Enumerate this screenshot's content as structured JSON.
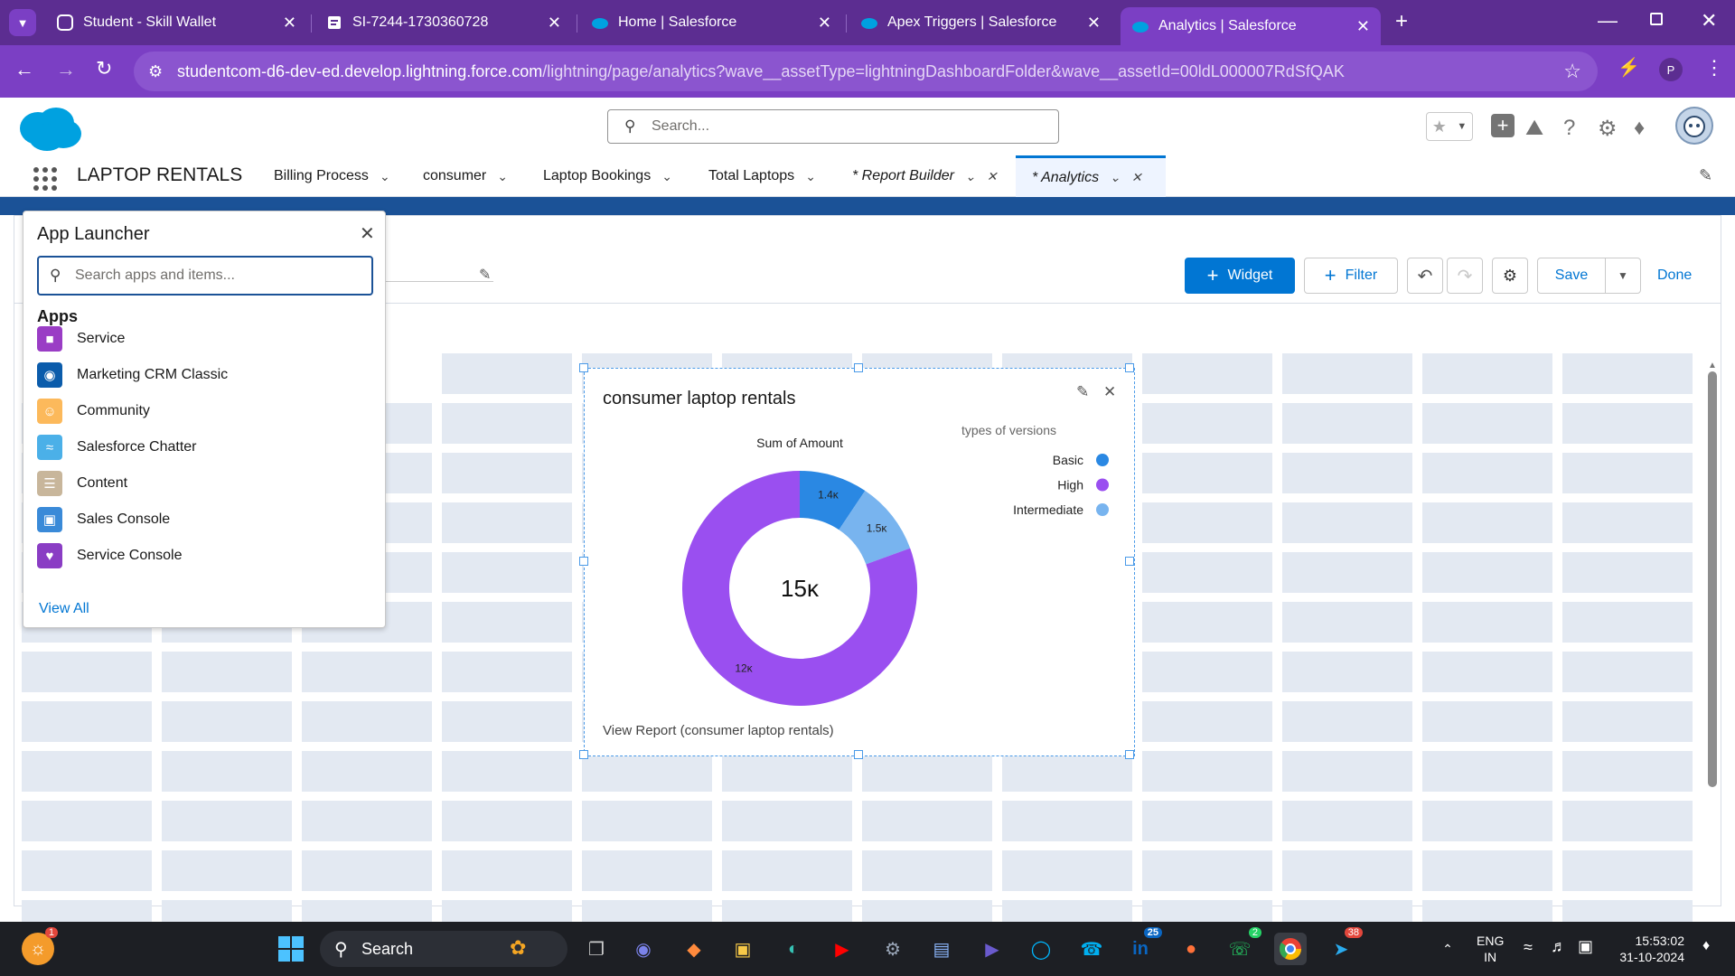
{
  "browser": {
    "tabs": [
      {
        "title": "Student - Skill Wallet"
      },
      {
        "title": "SI-7244-1730360728"
      },
      {
        "title": "Home | Salesforce"
      },
      {
        "title": "Apex Triggers | Salesforce"
      },
      {
        "title": "Analytics | Salesforce"
      }
    ],
    "url_host": "studentcom-d6-dev-ed.develop.lightning.force.com",
    "url_path": "/lightning/page/analytics?wave__assetType=lightningDashboardFolder&wave__assetId=00ldL000007RdSfQAK",
    "profile_initial": "P"
  },
  "sf": {
    "search_placeholder": "Search...",
    "app_name": "LAPTOP RENTALS",
    "nav": [
      {
        "label": "Billing Process"
      },
      {
        "label": "consumer"
      },
      {
        "label": "Laptop Bookings"
      },
      {
        "label": "Total Laptops"
      },
      {
        "label": "* Report Builder"
      },
      {
        "label": "* Analytics"
      }
    ]
  },
  "toolbar": {
    "widget_label": "Widget",
    "filter_label": "Filter",
    "save_label": "Save",
    "done_label": "Done"
  },
  "launcher": {
    "title": "App Launcher",
    "search_placeholder": "Search apps and items...",
    "section": "Apps",
    "apps": [
      {
        "label": "Service",
        "color": "#9a3dc5"
      },
      {
        "label": "Marketing CRM Classic",
        "color": "#0b5cab"
      },
      {
        "label": "Community",
        "color": "#fcb95b"
      },
      {
        "label": "Salesforce Chatter",
        "color": "#4bb0e8"
      },
      {
        "label": "Content",
        "color": "#c8b69b"
      },
      {
        "label": "Sales Console",
        "color": "#3a8ad8"
      },
      {
        "label": "Service Console",
        "color": "#8a3dc4"
      }
    ],
    "view_all": "View All"
  },
  "widget": {
    "title": "consumer laptop rentals",
    "footer_link": "View Report (consumer laptop rentals)"
  },
  "chart_data": {
    "type": "pie",
    "title": "Sum of Amount",
    "center_label": "15ĸ",
    "legend_title": "types of versions",
    "legend_position": "right",
    "series": [
      {
        "name": "Basic",
        "value": 1.4,
        "label": "1.4ĸ",
        "color": "#2a88e3"
      },
      {
        "name": "Intermediate",
        "value": 1.5,
        "label": "1.5ĸ",
        "color": "#78b4ef"
      },
      {
        "name": "High",
        "value": 12,
        "label": "12ĸ",
        "color": "#9a4ff0"
      }
    ]
  },
  "taskbar": {
    "search_label": "Search",
    "lang_top": "ENG",
    "lang_bottom": "IN",
    "time": "15:53:02",
    "date": "31-10-2024",
    "badges": {
      "linkedin": "25",
      "whatsapp": "2",
      "telegram": "38",
      "weather": "1"
    }
  }
}
